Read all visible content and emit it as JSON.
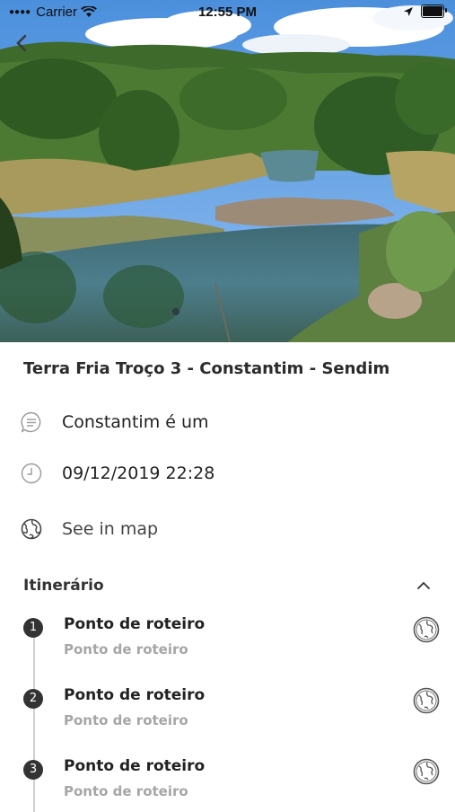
{
  "status_bar": {
    "carrier": "Carrier",
    "time": "12:55 PM"
  },
  "icons": {
    "back": "chevron-left-icon",
    "description": "speech-bubble-icon",
    "date": "clock-icon",
    "map": "globe-icon",
    "collapse": "chevron-up-icon"
  },
  "route": {
    "title": "Terra Fria Troço 3 - Constantim - Sendim",
    "description": "Constantim é um",
    "datetime": "09/12/2019 22:28",
    "map_link": "See in map"
  },
  "itinerary": {
    "label": "Itinerário",
    "points": [
      {
        "number": "1",
        "name": "Ponto de roteiro",
        "subtitle": "Ponto de roteiro"
      },
      {
        "number": "2",
        "name": "Ponto de roteiro",
        "subtitle": "Ponto de roteiro"
      },
      {
        "number": "3",
        "name": "Ponto de roteiro",
        "subtitle": "Ponto de roteiro"
      }
    ]
  },
  "colors": {
    "text_dark": "#2b2b2b",
    "text_muted": "#a6a6a6",
    "badge": "#333333",
    "timeline": "#cfcfcf"
  }
}
